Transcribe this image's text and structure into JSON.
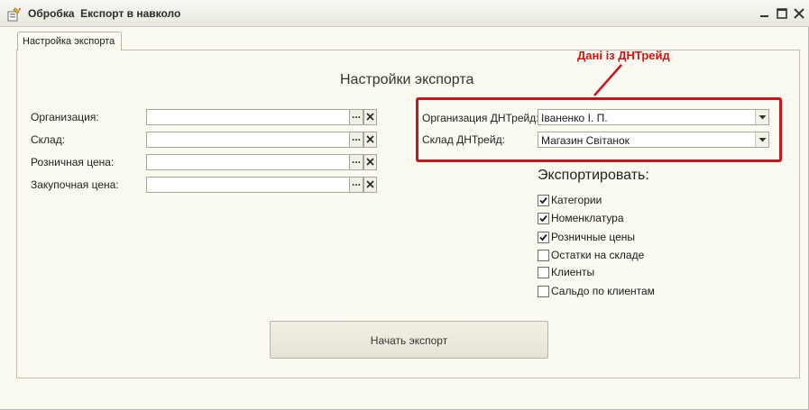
{
  "window": {
    "title": "Обробка  Експорт в навколо",
    "minimize_icon": "minimize-icon",
    "maximize_icon": "maximize-icon",
    "close_icon": "close-icon"
  },
  "tabs": [
    {
      "label": "Настройка экспорта",
      "active": true
    }
  ],
  "form": {
    "heading": "Настройки экспорта",
    "left_fields": [
      {
        "label": "Организация:",
        "value": ""
      },
      {
        "label": "Склад:",
        "value": ""
      },
      {
        "label": "Розничная цена:",
        "value": ""
      },
      {
        "label": "Закупочная цена:",
        "value": ""
      }
    ],
    "select_button_text": "...",
    "right_fields": [
      {
        "label": "Организация ДНТрейд:",
        "value": "Іваненко І. П."
      },
      {
        "label": "Склад ДНТрейд:",
        "value": "Магазин Світанок"
      }
    ],
    "annotation": {
      "text": "Дані із ДНТрейд",
      "color": "#c4161c"
    },
    "export": {
      "title": "Экспортировать:",
      "options": [
        {
          "label": "Категории",
          "checked": true
        },
        {
          "label": "Номенклатура",
          "checked": true
        },
        {
          "label": "Розничные цены",
          "checked": true
        },
        {
          "label": "Остатки на складе",
          "checked": false
        },
        {
          "label": "Клиенты",
          "checked": false
        },
        {
          "label": "Сальдо по клиентам",
          "checked": false
        }
      ]
    },
    "start_button": "Начать экспорт"
  }
}
